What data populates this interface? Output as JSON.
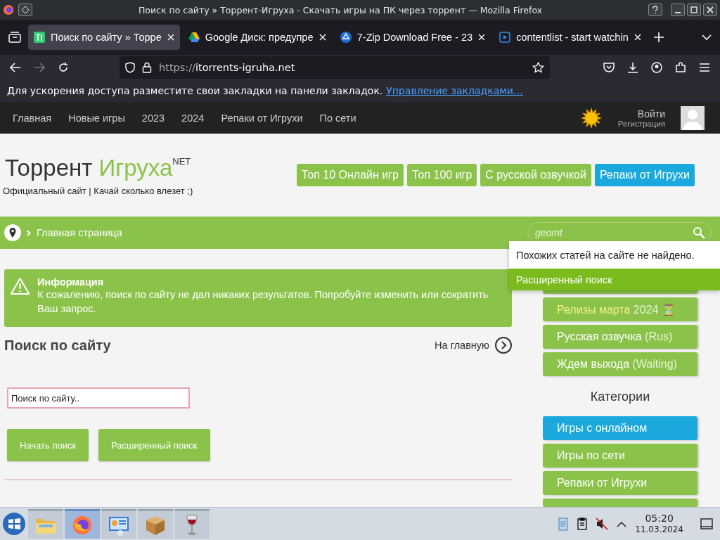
{
  "window": {
    "title": "Поиск по сайту » Торрент-Игруха - Скачать игры на ПК через торрент — Mozilla Firefox"
  },
  "tabs": [
    {
      "label": "Поиск по сайту » Торре",
      "kind": "site",
      "selected": true
    },
    {
      "label": "Google Диск: предупре",
      "kind": "drive",
      "selected": false
    },
    {
      "label": "7-Zip Download Free - 23",
      "kind": "zip",
      "selected": false
    },
    {
      "label": "contentlist - start watchin",
      "kind": "video",
      "selected": false
    }
  ],
  "address": {
    "scheme": "https://",
    "host": "itorrents-igruha.net"
  },
  "bookmarks_notice": {
    "text": "Для ускорения доступа разместите свои закладки на панели закладок.",
    "link": "Управление закладками…"
  },
  "site_nav": {
    "items": [
      "Главная",
      "Новые игры",
      "2023",
      "2024",
      "Репаки от Игрухи",
      "По сети"
    ],
    "login": "Войти",
    "register": "Регистрация"
  },
  "logo": {
    "word1": "Торрент",
    "word2": "Игруха",
    "sup": "NET",
    "tagline": "Официальный сайт | Качай сколько влезет ;)"
  },
  "header_buttons": [
    {
      "label": "Топ 10 Онлайн игр",
      "color": "#8bc34a"
    },
    {
      "label": "Топ 100 игр",
      "color": "#8bc34a"
    },
    {
      "label": "С русской озвучкой",
      "color": "#8bc34a"
    },
    {
      "label": "Репаки от Игрухи",
      "color": "#1ba8dc"
    }
  ],
  "breadcrumb": {
    "label": "Главная страница"
  },
  "header_search": {
    "value": "geomt"
  },
  "dropdown": {
    "message": "Похожих статей на сайте не найдено.",
    "link": "Расширенный поиск"
  },
  "info": {
    "title": "Информация",
    "text": "К сожалению, поиск по сайту не дал никаких результатов. Попробуйте изменить или сократить Ваш запрос."
  },
  "page_title": "Поиск по сайту",
  "home_link": "На главную",
  "search_form": {
    "value": "Поиск по сайту..",
    "buttons": [
      "Начать поиск",
      "Расширенный поиск"
    ]
  },
  "sidebar": {
    "items": [
      {
        "label": "Релизы марта",
        "suffix": "2024 ⏳",
        "kind": "release"
      },
      {
        "label": "Русская озвучка",
        "suffix": "(Rus)",
        "kind": "normal"
      },
      {
        "label": "Ждем выхода",
        "suffix": "(Waiting)",
        "kind": "normal"
      }
    ],
    "categories_title": "Категории",
    "categories": [
      {
        "label": "Игры с онлайном",
        "color": "#1ba8dc"
      },
      {
        "label": "Игры по сети",
        "color": "#8bc34a"
      },
      {
        "label": "Репаки от Игрухи",
        "color": "#8bc34a"
      }
    ]
  },
  "taskbar": {
    "apps": [
      {
        "kind": "folder",
        "selected": false
      },
      {
        "kind": "firefox",
        "selected": true
      },
      {
        "kind": "monitor",
        "selected": false
      },
      {
        "kind": "package",
        "selected": false
      },
      {
        "kind": "wine",
        "selected": false
      }
    ],
    "time": "05:20",
    "date": "11.03.2024"
  }
}
